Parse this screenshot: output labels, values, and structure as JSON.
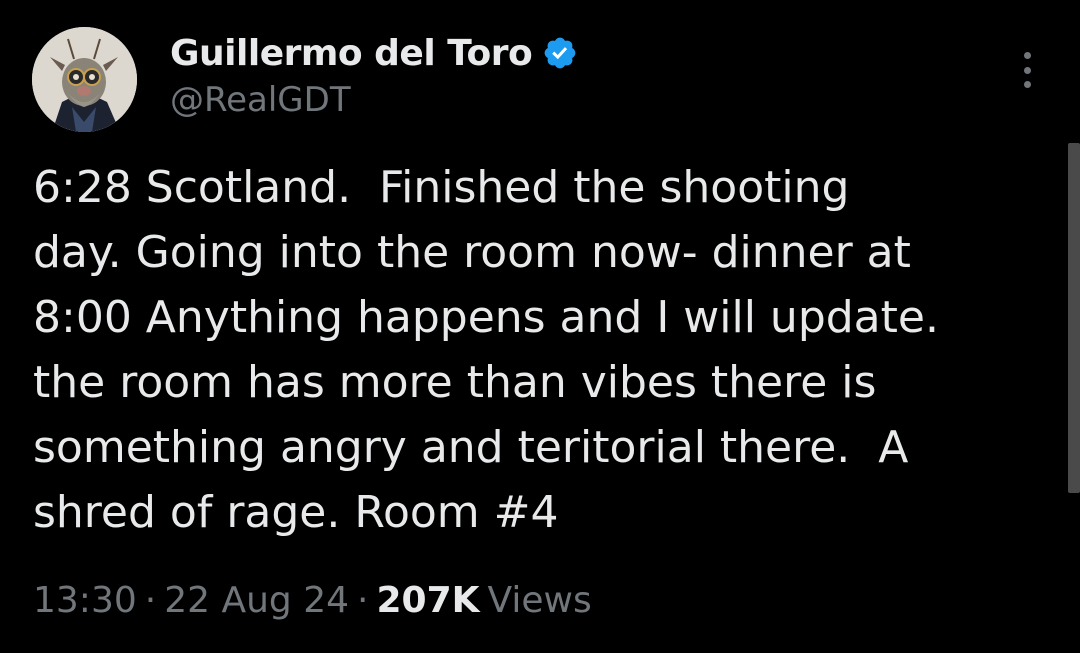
{
  "author": {
    "display_name": "Guillermo del Toro",
    "handle": "@RealGDT",
    "verified": true,
    "verified_color": "#1d9bf0",
    "avatar": "puppet-character-avatar"
  },
  "tweet": {
    "lines": [
      "6:28 Scotland.  Finished the shooting",
      "day. Going into the room now- dinner at",
      "8:00 Anything happens and I will update.",
      "the room has more than vibes there is",
      "something angry and teritorial there.  A",
      "shred of rage. Room #4"
    ]
  },
  "meta": {
    "time": "13:30",
    "separator": "·",
    "date": "22 Aug 24",
    "views_count": "207K",
    "views_label": "Views"
  },
  "icons": {
    "more": "more-vertical-icon",
    "verified": "verified-badge-icon"
  },
  "colors": {
    "background": "#000000",
    "primary_text": "#e7e9ea",
    "secondary_text": "#71767b"
  }
}
